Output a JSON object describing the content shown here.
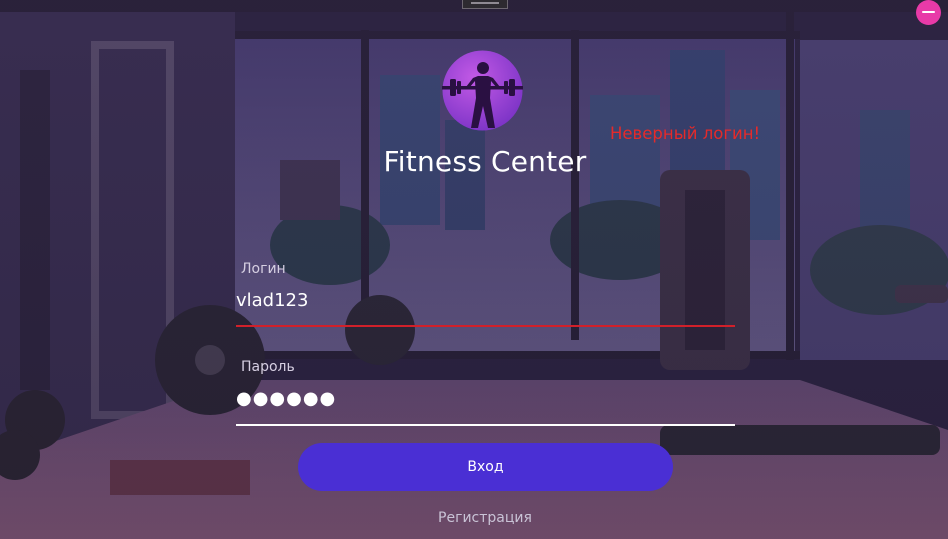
{
  "app": {
    "title": "Fitness Center"
  },
  "status": {
    "error": "Неверный логин!"
  },
  "login_form": {
    "login_label": "Логин",
    "login_value": "vlad123",
    "password_label": "Пароль",
    "password_masked": "●●●●●●",
    "submit_label": "Вход",
    "register_label": "Регистрация"
  },
  "icons": {
    "minimize": "minimize-icon",
    "logo": "fitness-logo-icon"
  },
  "colors": {
    "accent": "#4a2fd4",
    "error": "#e52a2a",
    "minimize": "#e83aa8",
    "logo_gradient_start": "#b04ad8",
    "logo_gradient_end": "#7a34c8"
  }
}
